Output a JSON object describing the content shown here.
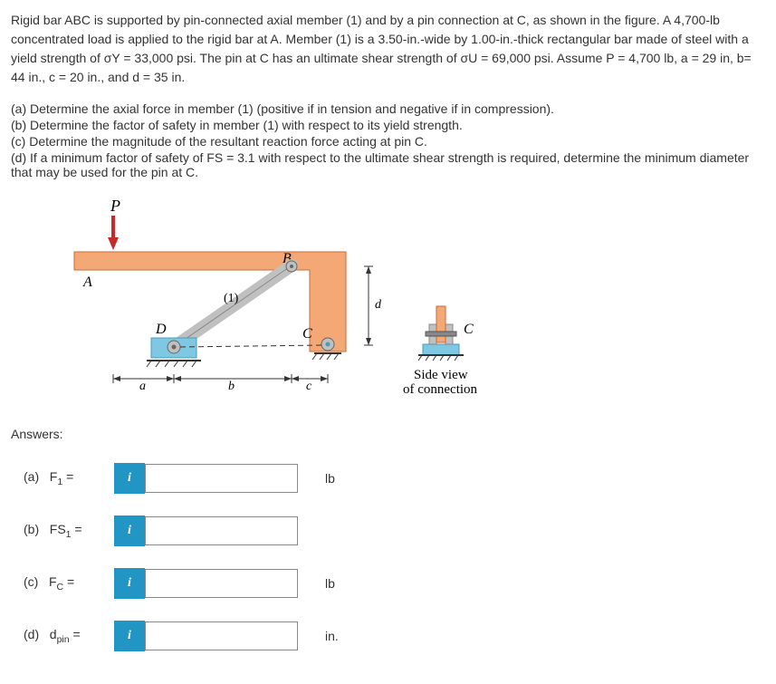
{
  "problem": {
    "paragraph1": "Rigid bar ABC is supported by pin-connected axial member (1) and by a pin connection at C, as shown in the figure. A 4,700-lb concentrated load is applied to the rigid bar at A. Member (1) is a 3.50-in.-wide by 1.00-in.-thick rectangular bar made of steel with a yield strength of σY  =  33,000 psi. The pin at C has an ultimate shear strength of σU  =   69,000 psi. Assume P = 4,700 lb, a = 29 in, b= 44 in., c = 20 in., and d = 35 in."
  },
  "parts": {
    "a": "(a) Determine the axial force in member (1) (positive if in tension and negative if in compression).",
    "b": "(b) Determine the factor of safety in member (1) with respect to its yield strength.",
    "c": "(c) Determine the magnitude of the resultant reaction force acting at pin C.",
    "d": "(d) If a minimum factor of safety of FS = 3.1 with respect to the ultimate shear strength is required, determine the minimum diameter that may be used for the pin at C."
  },
  "figure": {
    "P": "P",
    "A": "A",
    "B": "B",
    "C": "C",
    "D": "D",
    "one": "(1)",
    "a": "a",
    "b": "b",
    "c": "c",
    "d": "d",
    "side_view": "Side view",
    "of_connection": "of connection",
    "C_label": "C"
  },
  "answers_header": "Answers:",
  "answers": {
    "a": {
      "label": "(a)   F₁ =",
      "unit": "lb"
    },
    "b": {
      "label": "(b)   FS₁ =",
      "unit": ""
    },
    "c": {
      "label": "(c)   FC =",
      "unit": "lb"
    },
    "d": {
      "label": "(d)   dpin =",
      "unit": "in."
    }
  },
  "info_icon": "i"
}
